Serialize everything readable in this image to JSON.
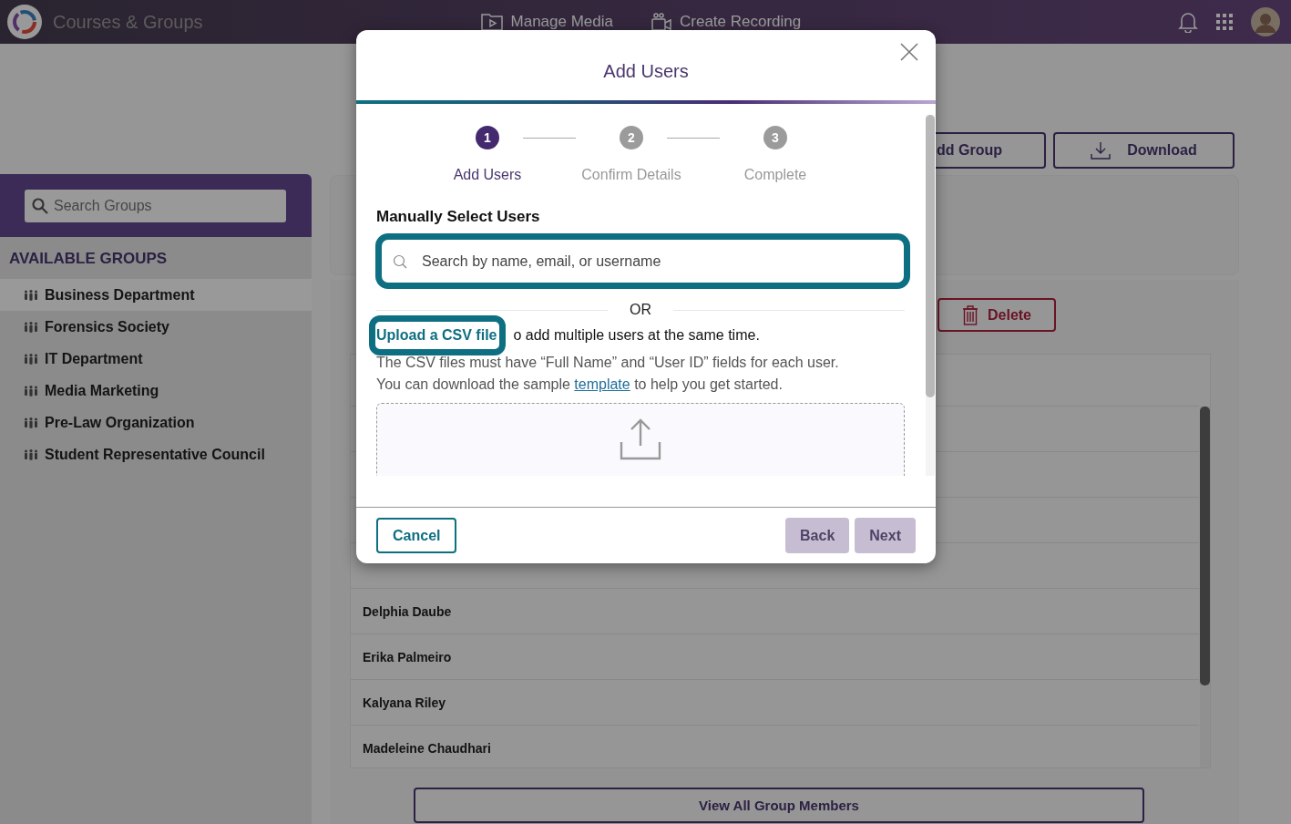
{
  "top_bar": {
    "title": "Courses & Groups",
    "nav": [
      {
        "label": "Manage Media"
      },
      {
        "label": "Create Recording"
      }
    ]
  },
  "sidebar": {
    "search": {
      "placeholder": "Search Groups"
    },
    "heading": "AVAILABLE GROUPS",
    "groups": [
      {
        "name": "Business Department",
        "selected": true
      },
      {
        "name": "Forensics Society",
        "selected": false
      },
      {
        "name": "IT Department",
        "selected": false
      },
      {
        "name": "Media Marketing",
        "selected": false
      },
      {
        "name": "Pre-Law Organization",
        "selected": false
      },
      {
        "name": "Student Representative Council",
        "selected": false
      }
    ]
  },
  "toolbar": {
    "buttons": [
      {
        "label": "dd Group",
        "kind": "plain"
      },
      {
        "label": "Download",
        "kind": "download"
      }
    ]
  },
  "delete_button": "Delete",
  "members": [
    "Delphia Daube",
    "Erika Palmeiro",
    "Kalyana Riley",
    "Madeleine Chaudhari"
  ],
  "view_all_button": "View All Group Members",
  "dialog": {
    "title": "Add Users",
    "steps": [
      {
        "number": "1",
        "label": "Add Users",
        "selected": true
      },
      {
        "number": "2",
        "label": "Confirm Details",
        "selected": false
      },
      {
        "number": "3",
        "label": "Complete",
        "selected": false
      }
    ],
    "section_title": "Manually Select Users",
    "search": {
      "placeholder": "Search by name, email, or username"
    },
    "divider": "OR",
    "upload_link": "Upload a CSV file",
    "upload_text": "o add multiple users at the same time.",
    "help_line": "The CSV files must have “Full Name” and “User ID” fields for each user.",
    "help_before": "You can download the sample ",
    "help_link": "template",
    "help_after": " to help you get started.",
    "buttons": [
      {
        "label": "Cancel",
        "kind": "outline",
        "disabled": false
      },
      {
        "label": "Back",
        "kind": "filled",
        "disabled": true
      },
      {
        "label": "Next",
        "kind": "filled",
        "disabled": true
      }
    ]
  }
}
